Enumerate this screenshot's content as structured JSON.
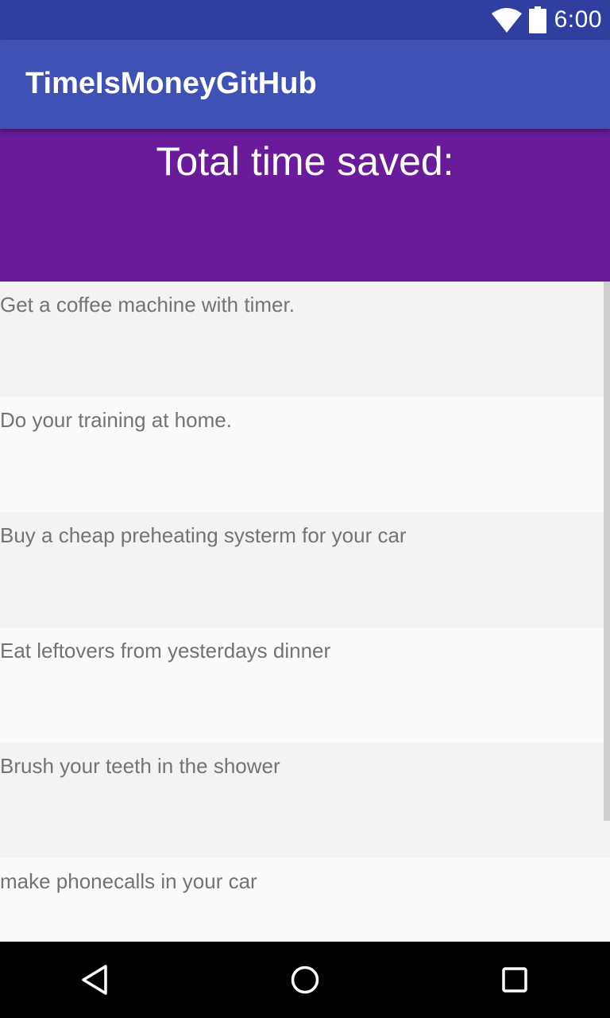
{
  "status_bar": {
    "time": "6:00",
    "icons": [
      "wifi-icon",
      "battery-icon"
    ],
    "color": "#303f9f"
  },
  "app_bar": {
    "title": "TimeIsMoneyGitHub",
    "color": "#3f51b5"
  },
  "header": {
    "total_label": "Total time saved:",
    "color": "#6a1b9a"
  },
  "tips": [
    "Get a coffee machine with timer.",
    "Do your training at home.",
    "Buy a cheap preheating systerm for your car",
    "Eat leftovers from yesterdays dinner",
    "Brush your teeth in the shower",
    "make phonecalls in your car"
  ],
  "nav_bar": {
    "buttons": [
      "back-icon",
      "home-icon",
      "recents-icon"
    ]
  }
}
